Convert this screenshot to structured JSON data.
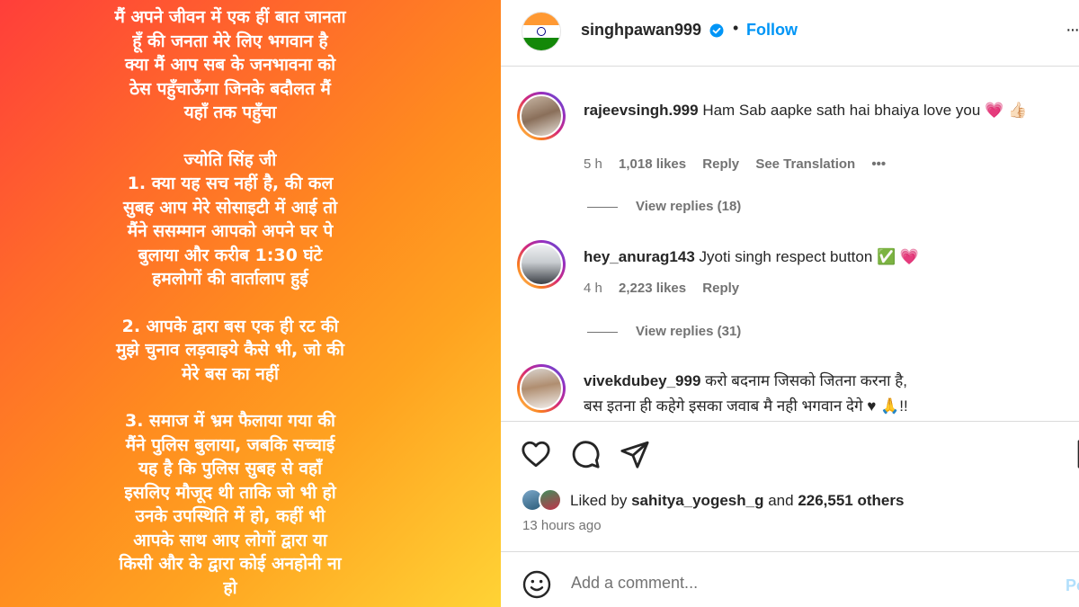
{
  "post_image": {
    "paragraphs": [
      [
        "मैं अपने जीवन में एक हीं बात जानता",
        "हूँ की जनता मेरे लिए भगवान है",
        "क्या मैं आप सब के जनभावना को",
        "ठेस पहुँचाऊँगा जिनके बदौलत मैं",
        "यहाँ तक पहुँचा"
      ],
      [
        "ज्योति सिंह जी",
        "1. क्या यह सच नहीं है, की कल",
        "सुबह आप मेरे सोसाइटी में आई तो",
        "मैंने ससम्मान आपको अपने घर पे",
        "बुलाया और करीब 1:30 घंटे",
        "हमलोगों की वार्तालाप हुई"
      ],
      [
        "2. आपके द्वारा बस एक ही रट की",
        "मुझे चुनाव लड़वाइये कैसे भी, जो की",
        "मेरे बस का नहीं"
      ],
      [
        "3. समाज में भ्रम फैलाया गया की",
        "मैंने पुलिस बुलाया, जबकि सच्चाई",
        "यह है कि पुलिस सुबह से वहाँ",
        "इसलिए मौजूद थी ताकि जो भी हो",
        "उनके उपस्थिति में हो, कहीं भी",
        "आपके साथ आए लोगों द्वारा या",
        "किसी और के द्वारा कोई अनहोनी ना",
        "हो"
      ]
    ]
  },
  "header": {
    "username": "singhpawan999",
    "separator": "•",
    "follow_label": "Follow",
    "more_label": "···"
  },
  "comments": [
    {
      "username": "rajeevsingh.999",
      "text": "Ham Sab aapke sath hai bhaiya love you",
      "emoji": "💗 👍🏻",
      "time": "5 h",
      "likes": "1,018 likes",
      "reply": "Reply",
      "translate": "See Translation",
      "more": "•••",
      "view_replies": "View replies (18)"
    },
    {
      "username": "hey_anurag143",
      "text": "Jyoti singh respect button",
      "emoji": "✅ 💗",
      "time": "4 h",
      "likes": "2,223 likes",
      "reply": "Reply",
      "view_replies": "View replies (31)"
    },
    {
      "username": "vivekdubey_999",
      "text_line1": "करो बदनाम जिसको जितना करना है,",
      "text_line2": "बस इतना ही कहेगे इसका जवाब मै नही भगवान देगे ♥ 🙏!!"
    }
  ],
  "likes": {
    "prefix": "Liked by",
    "user": "sahitya_yogesh_g",
    "conj": "and",
    "count": "226,551 others"
  },
  "timestamp": "13 hours ago",
  "add_comment": {
    "placeholder": "Add a comment...",
    "post_label": "Po"
  },
  "colors": {
    "follow": "#0095f6",
    "verified": "#0095f6",
    "muted": "#737373"
  }
}
